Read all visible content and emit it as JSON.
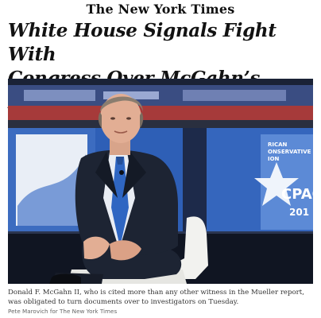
{
  "masthead": {
    "title": "The New York Times"
  },
  "article": {
    "headline_line1": "White House Signals Fight With",
    "headline_line2": "Congress Over McGahn’s Records"
  },
  "photo": {
    "backdrop_logo_text": "CPAC",
    "backdrop_year_text": "201",
    "backdrop_small_text": [
      "RICAN",
      "ONSERVATIVE",
      "ION"
    ]
  },
  "caption": {
    "line1": "Donald F. McGahn II, who is cited more than any other witness in the Mueller report,",
    "line2": "was obligated to turn documents over to investigators on Tuesday.",
    "credit": "Pete Marovich for The New York Times"
  },
  "colors": {
    "stage_blue": "#2b58a8",
    "stage_dark": "#141a2a",
    "backdrop_red": "#a63a3a",
    "chair_white": "#f2f2ef",
    "suit_navy": "#1d2433",
    "tie_blue": "#2f66c2"
  }
}
